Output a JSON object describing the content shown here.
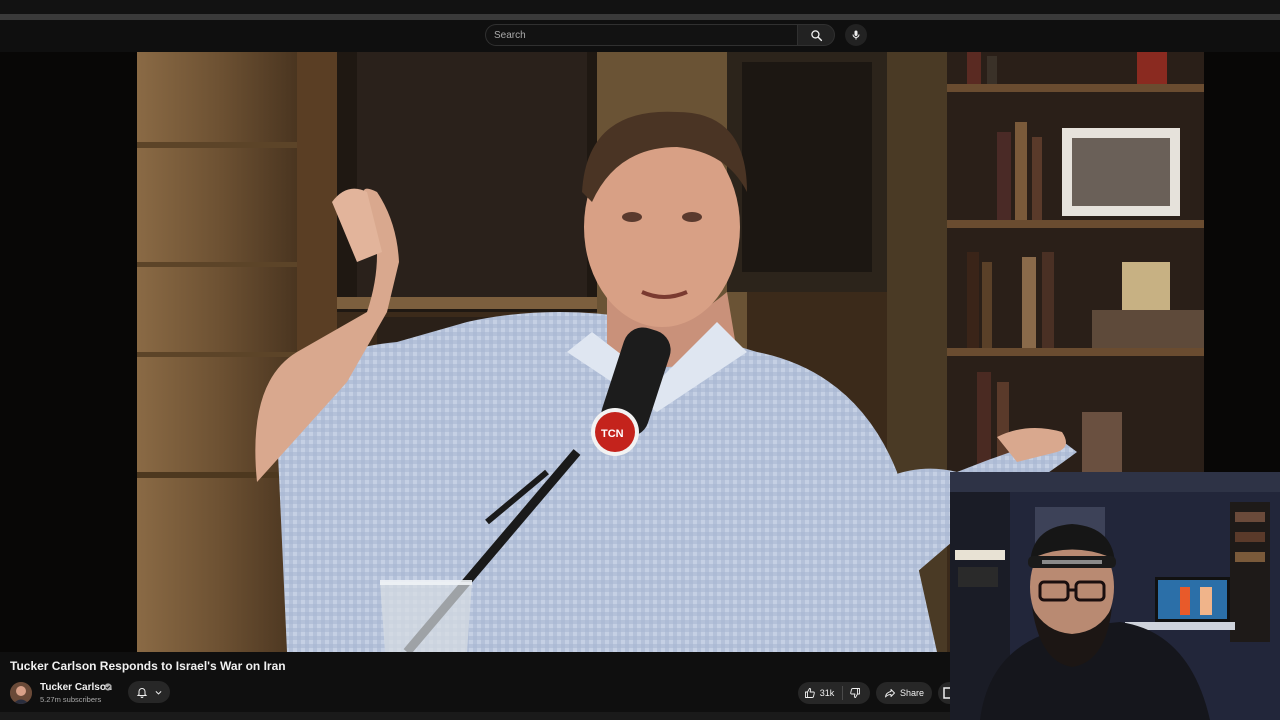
{
  "masthead": {
    "search_placeholder": "Search"
  },
  "video": {
    "title": "Tucker Carlson Responds to Israel's War on Iran",
    "mic_logo_text": "TCN"
  },
  "channel": {
    "name": "Tucker Carlson",
    "subscribers": "5.27m subscribers"
  },
  "actions": {
    "like_count": "31k",
    "share_label": "Share"
  },
  "colors": {
    "page_bg": "#0f0f0f",
    "button_bg": "#272727",
    "text": "#f1f1f1",
    "secondary_text": "#aaaaaa",
    "mic_logo_red": "#c4231c"
  },
  "icons": {
    "search": "search-icon",
    "mic": "microphone-icon",
    "bell": "bell-icon",
    "chevron": "chevron-down-icon",
    "like": "thumbs-up-icon",
    "dislike": "thumbs-down-icon",
    "share": "share-arrow-icon",
    "verified": "verified-check-icon"
  }
}
